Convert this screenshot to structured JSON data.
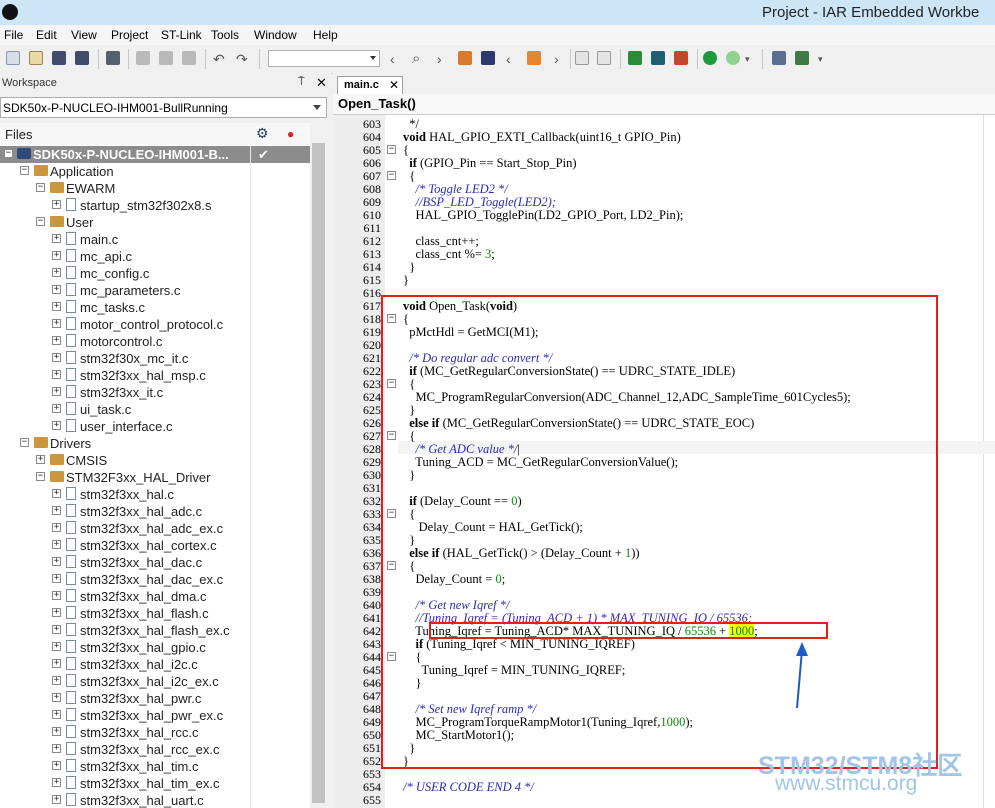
{
  "window": {
    "title": "Project - IAR Embedded Workbe"
  },
  "menu": [
    "File",
    "Edit",
    "View",
    "Project",
    "ST-Link",
    "Tools",
    "Window",
    "Help"
  ],
  "workspace": {
    "header": "Workspace",
    "pin_glyph": "⍑",
    "close_glyph": "✕",
    "config": "SDK50x-P-NUCLEO-IHM001-BullRunning",
    "files_label": "Files",
    "project_check": "✔",
    "tree": [
      {
        "indent": 0,
        "exp": "-",
        "type": "project",
        "name": "SDK50x-P-NUCLEO-IHM001-B...",
        "selected": true
      },
      {
        "indent": 1,
        "exp": "-",
        "type": "folder",
        "name": "Application"
      },
      {
        "indent": 2,
        "exp": "-",
        "type": "folder",
        "name": "EWARM"
      },
      {
        "indent": 3,
        "exp": "+",
        "type": "file",
        "name": "startup_stm32f302x8.s"
      },
      {
        "indent": 2,
        "exp": "-",
        "type": "folder",
        "name": "User"
      },
      {
        "indent": 3,
        "exp": "+",
        "type": "file",
        "name": "main.c"
      },
      {
        "indent": 3,
        "exp": "+",
        "type": "file",
        "name": "mc_api.c"
      },
      {
        "indent": 3,
        "exp": "+",
        "type": "file",
        "name": "mc_config.c"
      },
      {
        "indent": 3,
        "exp": "+",
        "type": "file",
        "name": "mc_parameters.c"
      },
      {
        "indent": 3,
        "exp": "+",
        "type": "file",
        "name": "mc_tasks.c"
      },
      {
        "indent": 3,
        "exp": "+",
        "type": "file",
        "name": "motor_control_protocol.c"
      },
      {
        "indent": 3,
        "exp": "+",
        "type": "file",
        "name": "motorcontrol.c"
      },
      {
        "indent": 3,
        "exp": "+",
        "type": "file",
        "name": "stm32f30x_mc_it.c"
      },
      {
        "indent": 3,
        "exp": "+",
        "type": "file",
        "name": "stm32f3xx_hal_msp.c"
      },
      {
        "indent": 3,
        "exp": "+",
        "type": "file",
        "name": "stm32f3xx_it.c"
      },
      {
        "indent": 3,
        "exp": "+",
        "type": "file",
        "name": "ui_task.c"
      },
      {
        "indent": 3,
        "exp": "+",
        "type": "file",
        "name": "user_interface.c"
      },
      {
        "indent": 1,
        "exp": "-",
        "type": "folder",
        "name": "Drivers"
      },
      {
        "indent": 2,
        "exp": "+",
        "type": "folder",
        "name": "CMSIS"
      },
      {
        "indent": 2,
        "exp": "-",
        "type": "folder",
        "name": "STM32F3xx_HAL_Driver"
      },
      {
        "indent": 3,
        "exp": "+",
        "type": "file",
        "name": "stm32f3xx_hal.c"
      },
      {
        "indent": 3,
        "exp": "+",
        "type": "file",
        "name": "stm32f3xx_hal_adc.c"
      },
      {
        "indent": 3,
        "exp": "+",
        "type": "file",
        "name": "stm32f3xx_hal_adc_ex.c"
      },
      {
        "indent": 3,
        "exp": "+",
        "type": "file",
        "name": "stm32f3xx_hal_cortex.c"
      },
      {
        "indent": 3,
        "exp": "+",
        "type": "file",
        "name": "stm32f3xx_hal_dac.c"
      },
      {
        "indent": 3,
        "exp": "+",
        "type": "file",
        "name": "stm32f3xx_hal_dac_ex.c"
      },
      {
        "indent": 3,
        "exp": "+",
        "type": "file",
        "name": "stm32f3xx_hal_dma.c"
      },
      {
        "indent": 3,
        "exp": "+",
        "type": "file",
        "name": "stm32f3xx_hal_flash.c"
      },
      {
        "indent": 3,
        "exp": "+",
        "type": "file",
        "name": "stm32f3xx_hal_flash_ex.c"
      },
      {
        "indent": 3,
        "exp": "+",
        "type": "file",
        "name": "stm32f3xx_hal_gpio.c"
      },
      {
        "indent": 3,
        "exp": "+",
        "type": "file",
        "name": "stm32f3xx_hal_i2c.c"
      },
      {
        "indent": 3,
        "exp": "+",
        "type": "file",
        "name": "stm32f3xx_hal_i2c_ex.c"
      },
      {
        "indent": 3,
        "exp": "+",
        "type": "file",
        "name": "stm32f3xx_hal_pwr.c"
      },
      {
        "indent": 3,
        "exp": "+",
        "type": "file",
        "name": "stm32f3xx_hal_pwr_ex.c"
      },
      {
        "indent": 3,
        "exp": "+",
        "type": "file",
        "name": "stm32f3xx_hal_rcc.c"
      },
      {
        "indent": 3,
        "exp": "+",
        "type": "file",
        "name": "stm32f3xx_hal_rcc_ex.c"
      },
      {
        "indent": 3,
        "exp": "+",
        "type": "file",
        "name": "stm32f3xx_hal_tim.c"
      },
      {
        "indent": 3,
        "exp": "+",
        "type": "file",
        "name": "stm32f3xx_hal_tim_ex.c"
      },
      {
        "indent": 3,
        "exp": "+",
        "type": "file",
        "name": "stm32f3xx_hal_uart.c"
      }
    ]
  },
  "editor": {
    "tab_label": "main.c",
    "tab_close": "✕",
    "function_label": "Open_Task()",
    "lines": [
      {
        "n": "603",
        "fold": "",
        "html": "  */"
      },
      {
        "n": "604",
        "fold": "",
        "html": "<span class='kw'>void</span> HAL_GPIO_EXTI_Callback(uint16_t GPIO_Pin)"
      },
      {
        "n": "605",
        "fold": "-",
        "html": "{"
      },
      {
        "n": "606",
        "fold": "",
        "html": "  <span class='kw'>if</span> (GPIO_Pin == Start_Stop_Pin)"
      },
      {
        "n": "607",
        "fold": "-",
        "html": "  {"
      },
      {
        "n": "608",
        "fold": "",
        "html": "    <span class='cm'>/* Toggle LED2 */</span>"
      },
      {
        "n": "609",
        "fold": "",
        "html": "    <span class='cm'>//BSP_LED_Toggle(LED2);</span>"
      },
      {
        "n": "610",
        "fold": "",
        "html": "    HAL_GPIO_TogglePin(LD2_GPIO_Port, LD2_Pin);"
      },
      {
        "n": "611",
        "fold": "",
        "html": ""
      },
      {
        "n": "612",
        "fold": "",
        "html": "    class_cnt++;"
      },
      {
        "n": "613",
        "fold": "",
        "html": "    class_cnt %= <span class='num'>3</span>;"
      },
      {
        "n": "614",
        "fold": "",
        "html": "  }"
      },
      {
        "n": "615",
        "fold": "",
        "html": "}"
      },
      {
        "n": "616",
        "fold": "",
        "html": ""
      },
      {
        "n": "617",
        "fold": "",
        "html": "<span class='kw'>void</span> Open_Task(<span class='kw'>void</span>)"
      },
      {
        "n": "618",
        "fold": "-",
        "html": "{"
      },
      {
        "n": "619",
        "fold": "",
        "html": "  pMctHdl = GetMCI(M1);"
      },
      {
        "n": "620",
        "fold": "",
        "html": ""
      },
      {
        "n": "621",
        "fold": "",
        "html": "  <span class='cm'>/* Do regular adc convert */</span>"
      },
      {
        "n": "622",
        "fold": "",
        "html": "  <span class='kw'>if</span> (MC_GetRegularConversionState() == UDRC_STATE_IDLE)"
      },
      {
        "n": "623",
        "fold": "-",
        "html": "  {"
      },
      {
        "n": "624",
        "fold": "",
        "html": "    MC_ProgramRegularConversion(ADC_Channel_12,ADC_SampleTime_601Cycles5);"
      },
      {
        "n": "625",
        "fold": "",
        "html": "  }"
      },
      {
        "n": "626",
        "fold": "",
        "html": "  <span class='kw'>else if</span> (MC_GetRegularConversionState() == UDRC_STATE_EOC)"
      },
      {
        "n": "627",
        "fold": "-",
        "html": "  {"
      },
      {
        "n": "628",
        "fold": "",
        "html": "    <span class='cm'>/* Get ADC value */</span>|"
      },
      {
        "n": "629",
        "fold": "",
        "html": "    Tuning_ACD = MC_GetRegularConversionValue();"
      },
      {
        "n": "630",
        "fold": "",
        "html": "  }"
      },
      {
        "n": "631",
        "fold": "",
        "html": ""
      },
      {
        "n": "632",
        "fold": "",
        "html": "  <span class='kw'>if</span> (Delay_Count == <span class='num'>0</span>)"
      },
      {
        "n": "633",
        "fold": "-",
        "html": "  {"
      },
      {
        "n": "634",
        "fold": "",
        "html": "     Delay_Count = HAL_GetTick();"
      },
      {
        "n": "635",
        "fold": "",
        "html": "  }"
      },
      {
        "n": "636",
        "fold": "",
        "html": "  <span class='kw'>else if</span> (HAL_GetTick() &gt; (Delay_Count + <span class='num'>1</span>))"
      },
      {
        "n": "637",
        "fold": "-",
        "html": "  {"
      },
      {
        "n": "638",
        "fold": "",
        "html": "    Delay_Count = <span class='num'>0</span>;"
      },
      {
        "n": "639",
        "fold": "",
        "html": ""
      },
      {
        "n": "640",
        "fold": "",
        "html": "    <span class='cm'>/* Get new Iqref */</span>"
      },
      {
        "n": "641",
        "fold": "",
        "html": "    <span class='cm'>//Tuning_Iqref = (Tuning_ACD + 1) * MAX_TUNING_IQ / 65536;</span>"
      },
      {
        "n": "642",
        "fold": "",
        "html": "    Tuning_Iqref = Tuning_ACD* MAX_TUNING_IQ / <span class='num'>65536</span> + <span class='num hl'>1000</span>;"
      },
      {
        "n": "643",
        "fold": "",
        "html": "    <span class='kw'>if</span> (Tuning_Iqref &lt; MIN_TUNING_IQREF)"
      },
      {
        "n": "644",
        "fold": "-",
        "html": "    {"
      },
      {
        "n": "645",
        "fold": "",
        "html": "      Tuning_Iqref = MIN_TUNING_IQREF;"
      },
      {
        "n": "646",
        "fold": "",
        "html": "    }"
      },
      {
        "n": "647",
        "fold": "",
        "html": ""
      },
      {
        "n": "648",
        "fold": "",
        "html": "    <span class='cm'>/* Set new Iqref ramp */</span>"
      },
      {
        "n": "649",
        "fold": "",
        "html": "    MC_ProgramTorqueRampMotor1(Tuning_Iqref,<span class='num'>1000</span>);"
      },
      {
        "n": "650",
        "fold": "",
        "html": "    MC_StartMotor1();"
      },
      {
        "n": "651",
        "fold": "",
        "html": "  }"
      },
      {
        "n": "652",
        "fold": "",
        "html": "}"
      },
      {
        "n": "653",
        "fold": "",
        "html": ""
      },
      {
        "n": "654",
        "fold": "",
        "html": "<span class='cm'>/* USER CODE END 4 */</span>"
      },
      {
        "n": "655",
        "fold": "",
        "html": ""
      }
    ]
  },
  "watermark": {
    "line1": "STM32/STM8社区",
    "line2": "www.stmcu.org"
  },
  "colors": {
    "keyword": "#000000",
    "comment": "#2b2bb0",
    "number": "#0a8a0a",
    "annotation": "#e0201c",
    "arrow": "#1e5bc8"
  }
}
